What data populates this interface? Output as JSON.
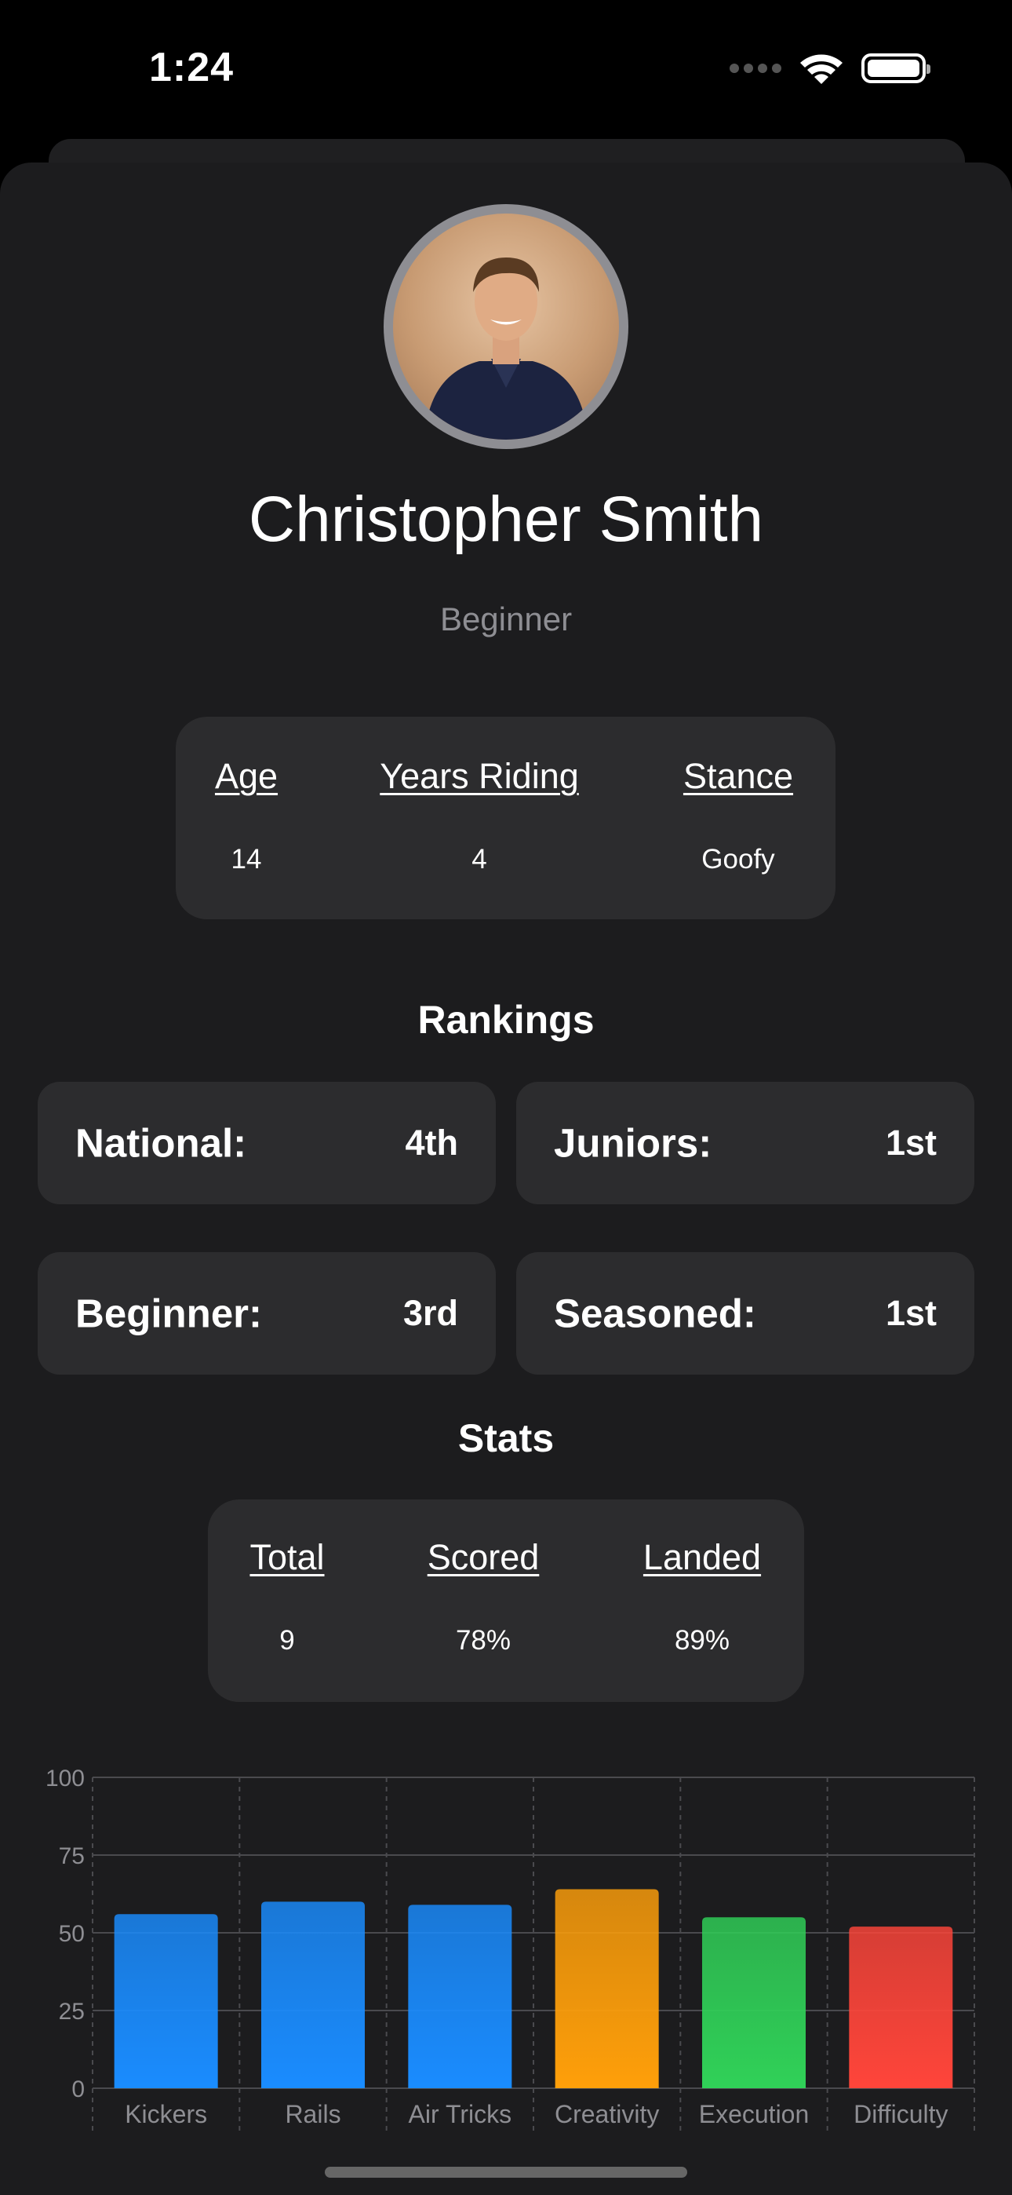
{
  "status_bar": {
    "time": "1:24"
  },
  "profile": {
    "name": "Christopher Smith",
    "level": "Beginner"
  },
  "info": {
    "age_label": "Age",
    "age_value": "14",
    "years_label": "Years Riding",
    "years_value": "4",
    "stance_label": "Stance",
    "stance_value": "Goofy"
  },
  "rankings": {
    "title": "Rankings",
    "items": [
      {
        "label": "National:",
        "value": "4th"
      },
      {
        "label": "Juniors:",
        "value": "1st"
      },
      {
        "label": "Beginner:",
        "value": "3rd"
      },
      {
        "label": "Seasoned:",
        "value": "1st"
      }
    ]
  },
  "stats": {
    "title": "Stats",
    "total_label": "Total",
    "total_value": "9",
    "scored_label": "Scored",
    "scored_value": "78%",
    "landed_label": "Landed",
    "landed_value": "89%"
  },
  "chart_data": {
    "type": "bar",
    "categories": [
      "Kickers",
      "Rails",
      "Air Tricks",
      "Creativity",
      "Execution",
      "Difficulty"
    ],
    "values": [
      56,
      60,
      59,
      64,
      55,
      52
    ],
    "colors": [
      "#1a8cff",
      "#1a8cff",
      "#1a8cff",
      "#ff9f0a",
      "#30d158",
      "#ff453a"
    ],
    "ylim": [
      0,
      100
    ],
    "yticks": [
      0,
      25,
      50,
      75,
      100
    ],
    "grid": true
  }
}
